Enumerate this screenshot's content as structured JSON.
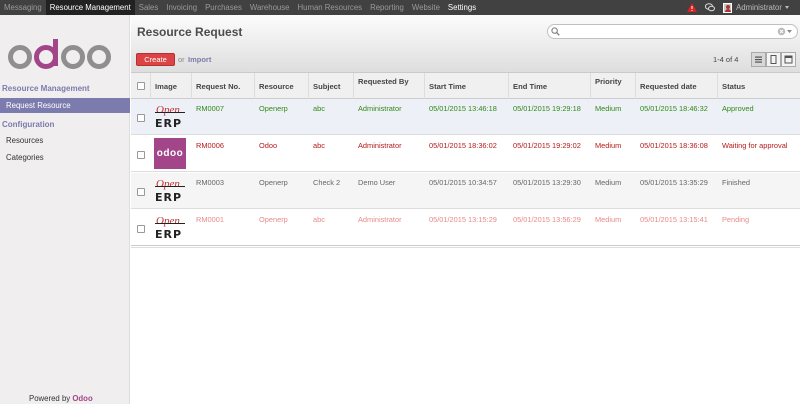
{
  "topbar": {
    "menu": [
      "Messaging",
      "Resource Management",
      "Sales",
      "Invoicing",
      "Purchases",
      "Warehouse",
      "Human Resources",
      "Reporting",
      "Website",
      "Settings"
    ],
    "active_index": 1,
    "user": "Administrator",
    "icons": [
      "warning-icon",
      "chat-icon",
      "user-avatar"
    ]
  },
  "sidebar": {
    "logo_text": "odoo",
    "sections": [
      {
        "title": "Resource Management",
        "items": [
          "Request Resource"
        ]
      },
      {
        "title": "Configuration",
        "items": [
          "Resources",
          "Categories"
        ]
      }
    ],
    "active_item": "Request Resource",
    "powered_by": "Powered by",
    "powered_brand": "Odoo"
  },
  "panel": {
    "title": "Resource Request",
    "search_placeholder": "",
    "create_label": "Create",
    "or_label": "or",
    "import_label": "Import",
    "pager": "1-4 of 4",
    "views": [
      "list-view",
      "form-view",
      "calendar-view"
    ]
  },
  "table": {
    "columns": [
      "Image",
      "Request No.",
      "Resource",
      "Subject",
      "Requested By",
      "Start Time",
      "End Time",
      "Priority",
      "Requested date",
      "Status"
    ],
    "rows": [
      {
        "image": "OpenERP",
        "request_no": "RM0007",
        "resource": "Openerp",
        "subject": "abc",
        "requested_by": "Administrator",
        "start": "05/01/2015 13:46:18",
        "end": "05/01/2015 19:29:18",
        "priority": "Medium",
        "requested_date": "05/01/2015 18:46:32",
        "status": "Approved",
        "color": "#2f8a16"
      },
      {
        "image": "odoo",
        "request_no": "RM0006",
        "resource": "Odoo",
        "subject": "abc",
        "requested_by": "Administrator",
        "start": "05/01/2015 18:36:02",
        "end": "05/01/2015 19:29:02",
        "priority": "Medium",
        "requested_date": "05/01/2015 18:36:08",
        "status": "Waiting for approval",
        "color": "#b51a1a"
      },
      {
        "image": "OpenERP",
        "request_no": "RM0003",
        "resource": "Openerp",
        "subject": "Check 2",
        "requested_by": "Demo User",
        "start": "05/01/2015 10:34:57",
        "end": "05/01/2015 13:29:30",
        "priority": "Medium",
        "requested_date": "05/01/2015 13:35:29",
        "status": "Finished",
        "color": "#666666"
      },
      {
        "image": "OpenERP",
        "request_no": "RM0001",
        "resource": "Openerp",
        "subject": "abc",
        "requested_by": "Administrator",
        "start": "05/01/2015 13:15:29",
        "end": "05/01/2015 13:56:29",
        "priority": "Medium",
        "requested_date": "05/01/2015 13:15:41",
        "status": "Pending",
        "color": "#e88a8a"
      }
    ]
  },
  "colors": {
    "brand": "#7c7bad",
    "create": "#dc4345",
    "odoo_logo": "#a24689",
    "topbar": "#414141"
  }
}
